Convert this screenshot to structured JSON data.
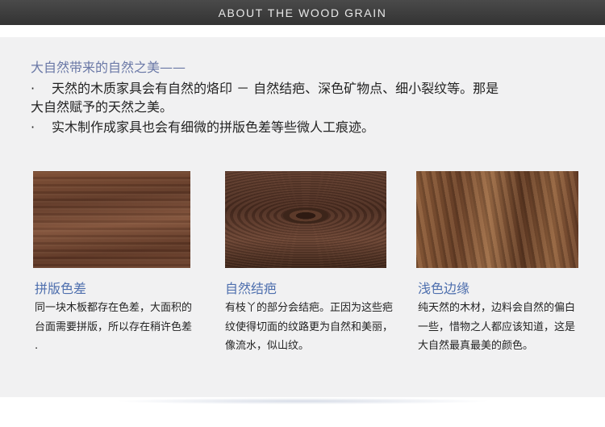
{
  "header": {
    "title": "ABOUT THE WOOD GRAIN"
  },
  "intro": {
    "heading": "大自然带来的自然之美——",
    "bullet": "·",
    "line1": "天然的木质家具会有自然的烙印 － 自然结疤、深色矿物点、细小裂纹等。那是",
    "line2": "大自然赋予的天然之美。",
    "line3": "实木制作成家具也会有细微的拼版色差等些微人工痕迹。"
  },
  "samples": [
    {
      "title": "拼版色差",
      "text": "同一块木板都存在色差，大面积的台面需要拼版，所以存在稍许色差 ."
    },
    {
      "title": "自然结疤",
      "text": "有枝丫的部分会结疤。正因为这些疤纹使得切面的纹路更为自然和美丽，像流水，似山纹。"
    },
    {
      "title": "浅色边缘",
      "text": "纯天然的木材，边料会自然的偏白一些，惜物之人都应该知道，这是大自然最真最美的颜色。"
    }
  ]
}
